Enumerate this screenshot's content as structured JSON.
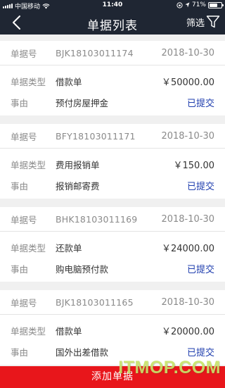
{
  "status_bar": {
    "carrier": "中国移动",
    "time": "11:40",
    "battery": "71%",
    "battery_level": 0.71
  },
  "navbar": {
    "title": "单据列表",
    "filter_label": "筛选"
  },
  "labels": {
    "doc_no": "单据号",
    "doc_type": "单据类型",
    "reason": "事由"
  },
  "documents": [
    {
      "number": "BJK18103011174",
      "date": "2018-10-30",
      "type": "借款单",
      "amount": "￥50000.00",
      "reason": "预付房屋押金",
      "status": "已提交"
    },
    {
      "number": "BFY18103011171",
      "date": "2018-10-30",
      "type": "费用报销单",
      "amount": "￥150.00",
      "reason": "报销邮寄费",
      "status": "已提交"
    },
    {
      "number": "BHK18103011169",
      "date": "2018-10-30",
      "type": "还款单",
      "amount": "￥24000.00",
      "reason": "购电脑预付款",
      "status": "已提交"
    },
    {
      "number": "BJK18103011165",
      "date": "2018-10-30",
      "type": "借款单",
      "amount": "￥20000.00",
      "reason": "国外出差借款",
      "status": "已提交"
    }
  ],
  "add_button": {
    "label": "添加单据"
  },
  "watermark": {
    "text": "ITMOP.COM"
  },
  "colors": {
    "header": "#1f2633",
    "status_text": "#1e3dae",
    "add_button": "#e8161b"
  }
}
